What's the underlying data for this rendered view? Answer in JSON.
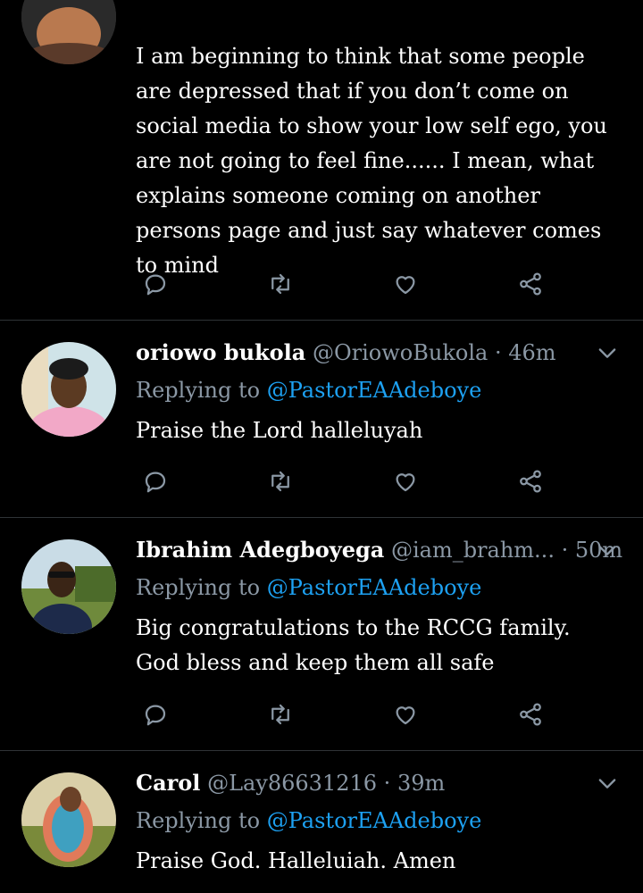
{
  "tweets": [
    {
      "body": "I am beginning to think that some people are depressed that if you don’t come on social media to show your low self ego, you are not going to feel fine...... I mean, what explains someone coming on another persons page and just say whatever comes to mind"
    },
    {
      "name": "oriowo bukola",
      "handle": "@OriowoBukola",
      "time": "46m",
      "reply_prefix": "Replying to",
      "reply_to": "@PastorEAAdeboye",
      "body": "Praise the Lord halleluyah"
    },
    {
      "name": "Ibrahim Adegboyega",
      "handle": "@iam_brahm...",
      "time": "50m",
      "reply_prefix": "Replying to",
      "reply_to": "@PastorEAAdeboye",
      "body": "Big congratulations to the RCCG family. God bless and keep them all safe"
    },
    {
      "name": "Carol",
      "handle": "@Lay86631216",
      "time": "39m",
      "reply_prefix": "Replying to",
      "reply_to": "@PastorEAAdeboye",
      "body": "Praise God. Halleluiah. Amen"
    }
  ],
  "separator": "·",
  "icons": {
    "reply": "reply-icon",
    "retweet": "retweet-icon",
    "like": "heart-icon",
    "share": "share-icon",
    "more": "chevron-down-icon"
  },
  "colors": {
    "background": "#000000",
    "text": "#ffffff",
    "secondary": "#8b98a5",
    "mention": "#1da1f2",
    "divider": "#2f3336"
  }
}
